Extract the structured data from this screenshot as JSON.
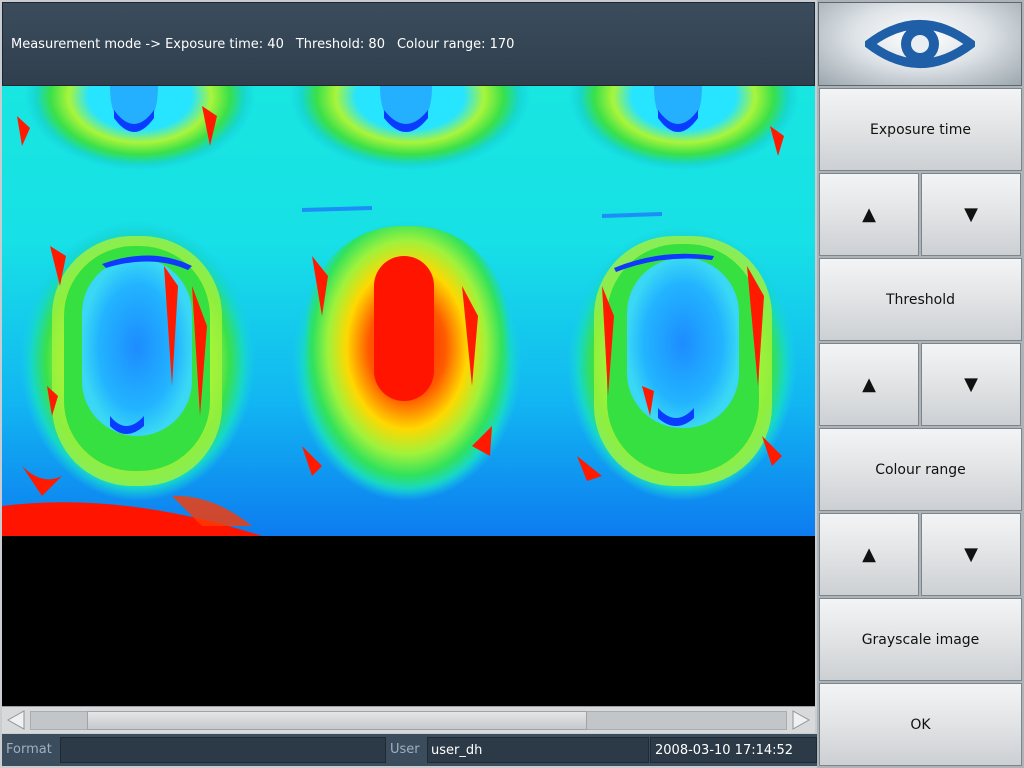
{
  "status": {
    "mode": "Measurement mode -> Exposure time: 40",
    "threshold": "Threshold: 80",
    "colour_range": "Colour range: 170"
  },
  "panel": {
    "logo_icon": "eye-logo-icon",
    "exposure_label": "Exposure time",
    "threshold_label": "Threshold",
    "colour_range_label": "Colour range",
    "grayscale_label": "Grayscale image",
    "ok_label": "OK",
    "up_arrow": "▲",
    "down_arrow": "▼"
  },
  "footer": {
    "format_label": "Format",
    "format_value": "",
    "user_label": "User",
    "user_value": "user_dh",
    "datetime": "2008-03-10 17:14:52"
  },
  "colors": {
    "header_bg": "#3b4c5c",
    "logo_blue": "#1f5fa8",
    "heat_red": "#ff1a00",
    "heat_blue": "#0a3cff"
  }
}
